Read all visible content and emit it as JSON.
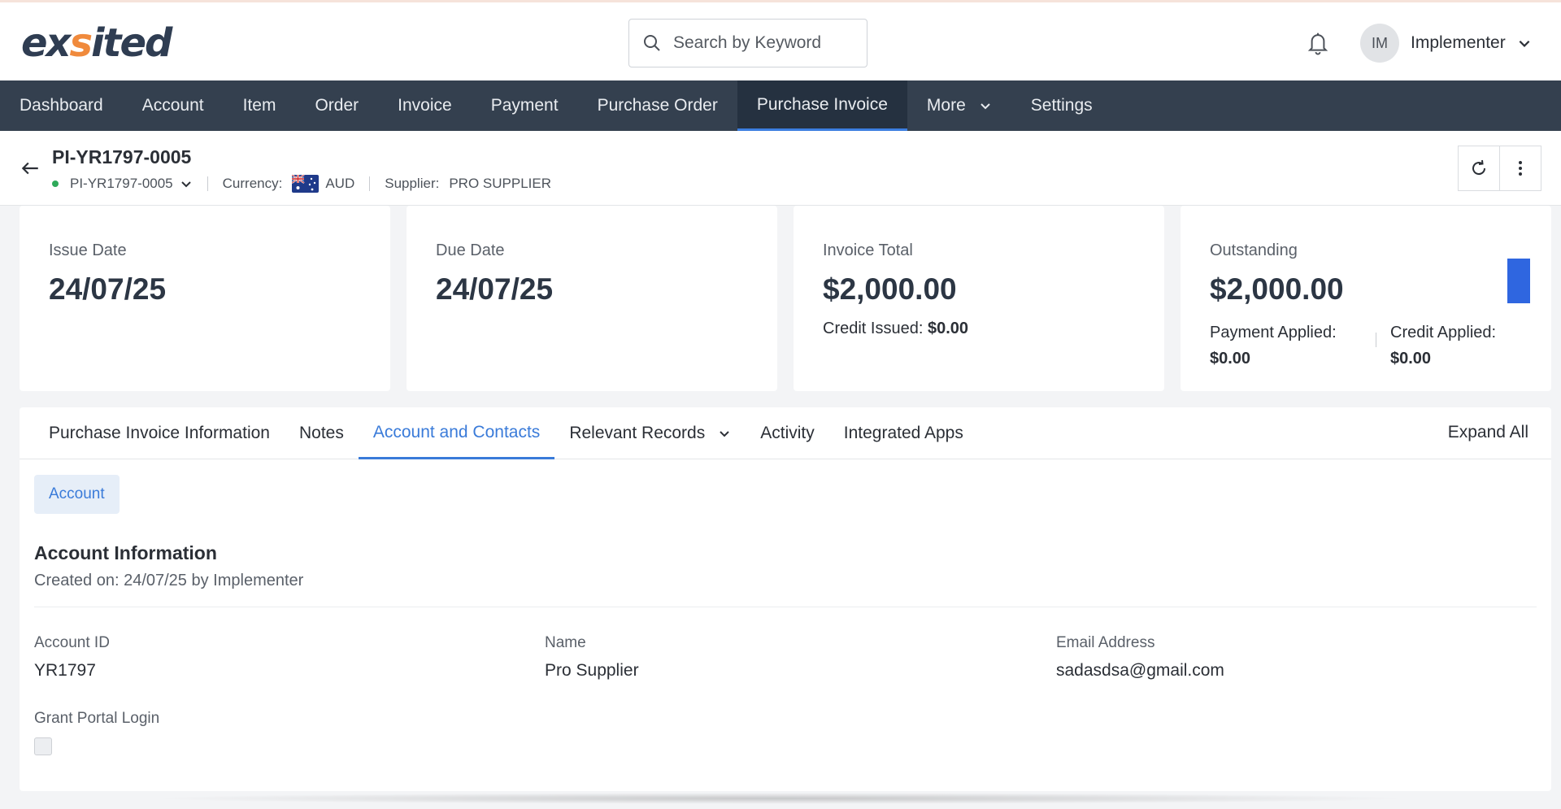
{
  "header": {
    "logo": {
      "part1": "ex",
      "part2": "s",
      "part3": "ited"
    },
    "search_placeholder": "Search by Keyword",
    "user": {
      "initials": "IM",
      "name": "Implementer"
    }
  },
  "nav": [
    {
      "label": "Dashboard"
    },
    {
      "label": "Account"
    },
    {
      "label": "Item"
    },
    {
      "label": "Order"
    },
    {
      "label": "Invoice"
    },
    {
      "label": "Payment"
    },
    {
      "label": "Purchase Order"
    },
    {
      "label": "Purchase Invoice",
      "active": true
    },
    {
      "label": "More",
      "dropdown": true
    },
    {
      "label": "Settings"
    }
  ],
  "record": {
    "title": "PI-YR1797-0005",
    "status_selector": "PI-YR1797-0005",
    "currency_label": "Currency:",
    "currency_value": "AUD",
    "supplier_label": "Supplier:",
    "supplier_value": "PRO SUPPLIER"
  },
  "cards": {
    "issue": {
      "label": "Issue Date",
      "value": "24/07/25"
    },
    "due": {
      "label": "Due Date",
      "value": "24/07/25"
    },
    "total": {
      "label": "Invoice Total",
      "value": "$2,000.00",
      "credit_issued_label": "Credit Issued:",
      "credit_issued_value": "$0.00"
    },
    "outstanding": {
      "label": "Outstanding",
      "value": "$2,000.00",
      "payment_applied_label": "Payment Applied:",
      "payment_applied_value": "$0.00",
      "credit_applied_label": "Credit Applied:",
      "credit_applied_value": "$0.00"
    }
  },
  "tabs": [
    {
      "label": "Purchase Invoice Information"
    },
    {
      "label": "Notes"
    },
    {
      "label": "Account and Contacts",
      "active": true
    },
    {
      "label": "Relevant Records",
      "dropdown": true
    },
    {
      "label": "Activity"
    },
    {
      "label": "Integrated Apps"
    }
  ],
  "expand_all": "Expand All",
  "account_section": {
    "chip": "Account",
    "title": "Account Information",
    "created": "Created on: 24/07/25 by Implementer",
    "fields": {
      "account_id": {
        "label": "Account ID",
        "value": "YR1797"
      },
      "name": {
        "label": "Name",
        "value": "Pro Supplier"
      },
      "email": {
        "label": "Email Address",
        "value": "sadasdsa@gmail.com"
      },
      "portal": {
        "label": "Grant Portal Login",
        "checked": false
      }
    }
  },
  "colors": {
    "nav_bg": "#34404f",
    "accent": "#3a7bd9",
    "logo_accent": "#f08a3c",
    "status_dot": "#2faa5a"
  }
}
